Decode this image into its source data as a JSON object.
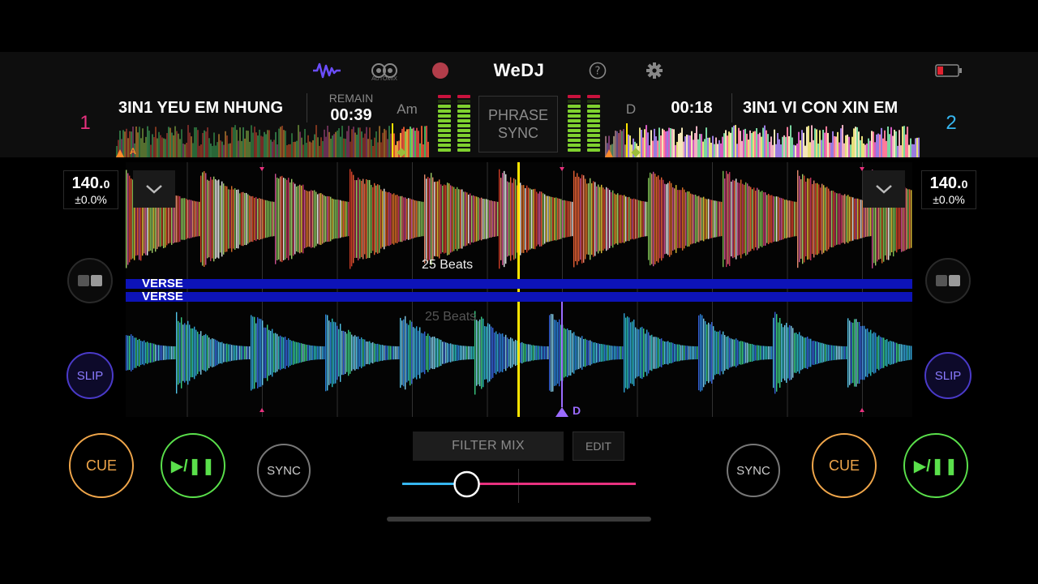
{
  "app": {
    "name": "WeDJ",
    "automix_label": "AUTOMIX"
  },
  "colors": {
    "deck1": "#e8317f",
    "deck2": "#36b6f0",
    "cue": "#f0a64a",
    "play": "#5ae04b",
    "slip": "#4a3ac9",
    "playhead": "#ffe400",
    "verse": "#0d13b8",
    "crossfader_left": "#36b6f0",
    "crossfader_right": "#e8317f"
  },
  "deck1": {
    "number": "1",
    "title": "3IN1 YEU EM NHUNG",
    "remain_label": "REMAIN",
    "time": "00:39",
    "key": "Am",
    "bpm_main": "140.",
    "bpm_decimal": "0",
    "pitch": "±0.0%",
    "beats_label": "25 Beats",
    "section": "VERSE",
    "slip_label": "SLIP",
    "cue_label": "CUE",
    "play_label": "▶/❚❚",
    "sync_label": "SYNC",
    "marker": "A"
  },
  "deck2": {
    "number": "2",
    "title": "3IN1 VI CON XIN EM",
    "time": "00:18",
    "key": "D",
    "bpm_main": "140.",
    "bpm_decimal": "0",
    "pitch": "±0.0%",
    "beats_label": "25 Beats",
    "section": "VERSE",
    "slip_label": "SLIP",
    "cue_label": "CUE",
    "play_label": "▶/❚❚",
    "sync_label": "SYNC",
    "marker": "D"
  },
  "center": {
    "phrase_line1": "PHRASE",
    "phrase_line2": "SYNC",
    "filter_label": "FILTER MIX",
    "edit_label": "EDIT",
    "crossfader_position": 0.27
  },
  "icons": [
    "waveform-icon",
    "automix-icon",
    "record-icon",
    "help-icon",
    "gear-icon",
    "battery-icon",
    "chevron-down-icon",
    "pad-toggle-icon"
  ]
}
